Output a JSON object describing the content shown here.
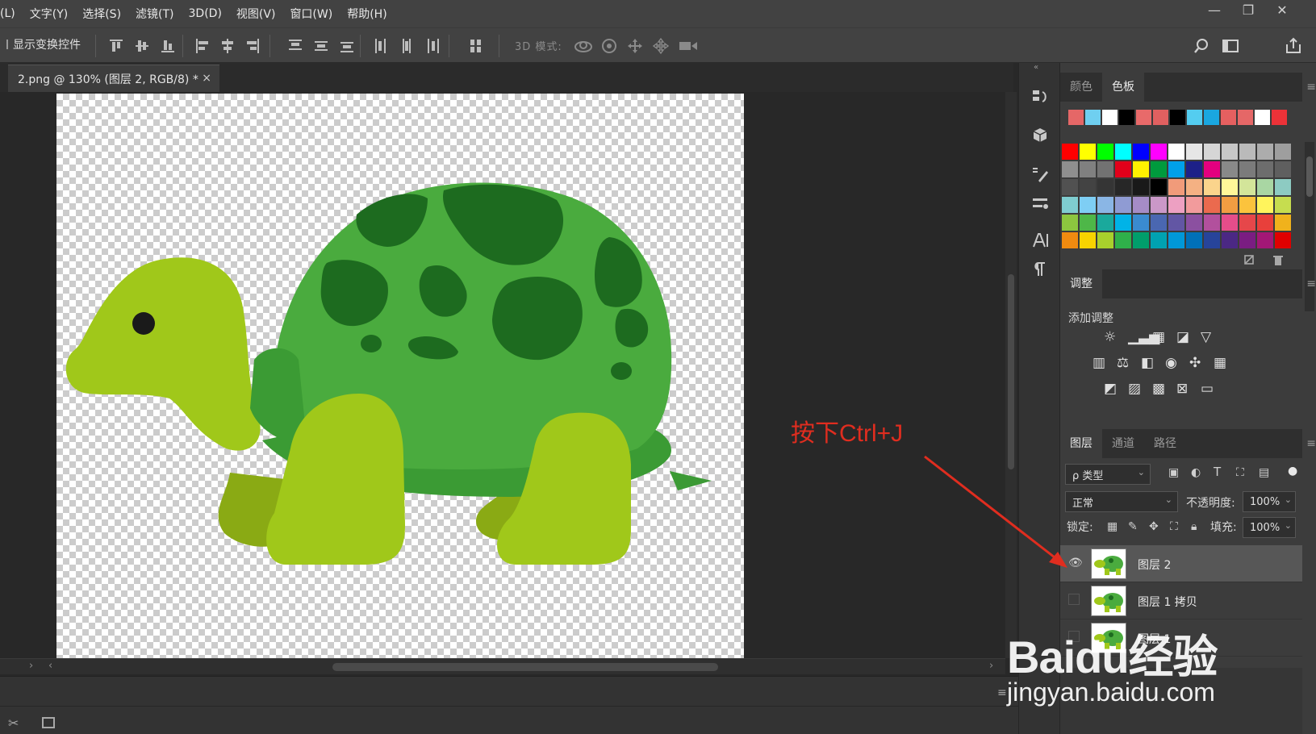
{
  "menubar": {
    "items": [
      "(L)",
      "文字(Y)",
      "选择(S)",
      "滤镜(T)",
      "3D(D)",
      "视图(V)",
      "窗口(W)",
      "帮助(H)"
    ]
  },
  "window_controls": {
    "minimize": "—",
    "restore": "❐",
    "close": "✕"
  },
  "options": {
    "show_transform_label": "显示变换控件",
    "mode_3d_label": "3D 模式:"
  },
  "document_tab": {
    "title": "2.png @ 130% (图层 2, RGB/8) *",
    "close": "×"
  },
  "swatches_panel": {
    "tabs": [
      "颜色",
      "色板"
    ],
    "active_tab": "色板",
    "recent": [
      "#e56767",
      "#6fcff0",
      "#ffffff",
      "#000000",
      "#e86a6a",
      "#e06060",
      "#000000",
      "#54cdf0",
      "#1aa7e0",
      "#e56060",
      "#e56767",
      "#ffffff",
      "#ec3238"
    ],
    "grid": [
      [
        "#ff0000",
        "#ffff00",
        "#00ff00",
        "#00ffff",
        "#0000ff",
        "#ff00ff",
        "#ffffff",
        "#e6e6e6",
        "#d6d6d6",
        "#c8c8c8",
        "#bababa",
        "#acacac",
        "#9e9e9e"
      ],
      [
        "#8f8f8f",
        "#808080",
        "#727272",
        "#e2001a",
        "#fff100",
        "#009a3d",
        "#00a0e9",
        "#1d2088",
        "#e4007f",
        "#898989",
        "#7b7b7b",
        "#6d6d6d",
        "#5f5f5f"
      ],
      [
        "#515151",
        "#434343",
        "#353535",
        "#272727",
        "#191919",
        "#000000",
        "#f19b7a",
        "#f4b183",
        "#fad48c",
        "#fff799",
        "#d3e59a",
        "#a9d6a3",
        "#8dcbc2"
      ],
      [
        "#7fcdd0",
        "#7ecef4",
        "#8ab6e5",
        "#8f9bd3",
        "#a58cc6",
        "#ca98c8",
        "#eda0c2",
        "#f29b9c",
        "#eb6a4e",
        "#f19d42",
        "#fbc33d",
        "#fff45c",
        "#c6dd4f"
      ],
      [
        "#8cc63f",
        "#4eb748",
        "#1aa99c",
        "#00b3e7",
        "#3a8bd0",
        "#4a67b1",
        "#6256a4",
        "#8b50a0",
        "#b2509d",
        "#e54d8a",
        "#e6474a",
        "#e8403b",
        "#f0b21c"
      ],
      [
        "#f08b10",
        "#f7d300",
        "#a8d02c",
        "#2fb04a",
        "#009e6b",
        "#00a2b1",
        "#0098d8",
        "#0070b8",
        "#27449a",
        "#4b2884",
        "#7a1d82",
        "#a31776",
        "#e00000"
      ]
    ]
  },
  "adjustments_panel": {
    "tab": "调整",
    "title": "添加调整",
    "icons": [
      [
        "brightness-icon",
        "levels-icon",
        "curves-icon",
        "exposure-icon",
        "vibrance-icon"
      ],
      [
        "hue-saturation-icon",
        "color-balance-icon",
        "black-white-icon",
        "photo-filter-icon",
        "channel-mixer-icon",
        "color-lookup-icon"
      ],
      [
        "invert-icon",
        "posterize-icon",
        "threshold-icon",
        "selective-color-icon",
        "gradient-map-icon"
      ]
    ]
  },
  "layers_panel": {
    "tabs": [
      "图层",
      "通道",
      "路径"
    ],
    "active_tab": "图层",
    "filter_label": "ρ 类型",
    "blend_mode": "正常",
    "opacity_label": "不透明度:",
    "opacity_value": "100%",
    "lock_label": "锁定:",
    "fill_label": "填充:",
    "fill_value": "100%",
    "layers": [
      {
        "name": "图层 2",
        "visible": true,
        "selected": true
      },
      {
        "name": "图层 1 拷贝",
        "visible": false,
        "selected": false
      },
      {
        "name": "图层 1",
        "visible": false,
        "selected": false
      }
    ]
  },
  "annotation": {
    "text": "按下Ctrl+J",
    "color": "#e02d1f"
  },
  "watermark": {
    "top": "Baidu经验",
    "bottom": "jingyan.baidu.com"
  },
  "colors": {
    "turtle_body": "#a0c81a",
    "turtle_shell": "#4aab3e",
    "turtle_spots": "#1d6b1f"
  }
}
